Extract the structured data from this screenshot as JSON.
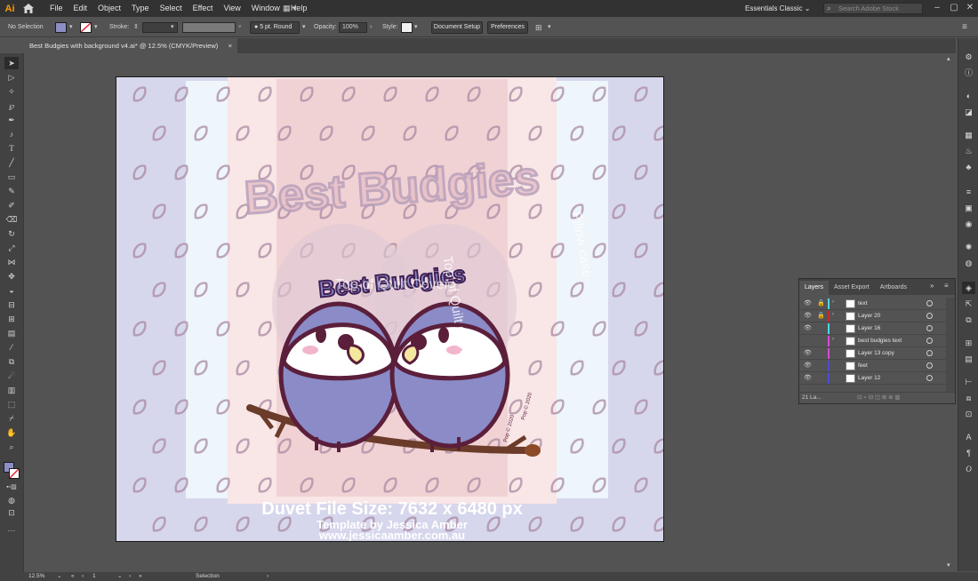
{
  "app": {
    "logo": "Ai",
    "workspace": "Essentials Classic",
    "search_placeholder": "Search Adobe Stock"
  },
  "menu": [
    "File",
    "Edit",
    "Object",
    "Type",
    "Select",
    "Effect",
    "View",
    "Window",
    "Help"
  ],
  "control_bar": {
    "selection": "No Selection",
    "stroke_label": "Stroke:",
    "brush": "5 pt. Round",
    "opacity_label": "Opacity:",
    "opacity_value": "100%",
    "style_label": "Style:",
    "document_setup": "Document Setup",
    "preferences": "Preferences",
    "fill_color": "#8d8ec4"
  },
  "document": {
    "tab_title": "Best Budgies with background v4.ai* @ 12.5% (CMYK/Preview)",
    "close": "×"
  },
  "artwork": {
    "headline_back": "Best Budgies",
    "headline_front": "Best Budgies",
    "arc_text_back": "Top of Quilt Cover",
    "side_text_1": "Top of Quilt Cover",
    "side_text_2": "Pillow case",
    "copyright_1": "Pop © 2020",
    "copyright_2": "Pop © 2020",
    "duvet_size": "Duvet File Size: 7632 x 6480 px",
    "template_by": "Template by Jessica Amber",
    "website": "www.jessicaamber.com.au"
  },
  "layers_panel": {
    "tabs": [
      "Layers",
      "Asset Export",
      "Artboards"
    ],
    "rows": [
      {
        "name": "text",
        "color": "#4fd3e8",
        "visible": true,
        "locked": true,
        "expand": true
      },
      {
        "name": "Layer 20",
        "color": "#c8252f",
        "visible": true,
        "locked": true,
        "expand": true
      },
      {
        "name": "Layer 16",
        "color": "#4fd3e8",
        "visible": true,
        "locked": false,
        "expand": false
      },
      {
        "name": "best budgies text",
        "color": "#d64ad6",
        "visible": false,
        "locked": false,
        "expand": true
      },
      {
        "name": "Layer 13 copy",
        "color": "#d64ad6",
        "visible": true,
        "locked": false,
        "expand": false
      },
      {
        "name": "feet",
        "color": "#4c4cd6",
        "visible": true,
        "locked": false,
        "expand": false
      },
      {
        "name": "Layer 12",
        "color": "#4c4cd6",
        "visible": true,
        "locked": false,
        "expand": false
      }
    ],
    "layer_count": "21 La..."
  },
  "status_bar": {
    "zoom": "12.5%",
    "artboard": "1",
    "tool": "Selection"
  }
}
